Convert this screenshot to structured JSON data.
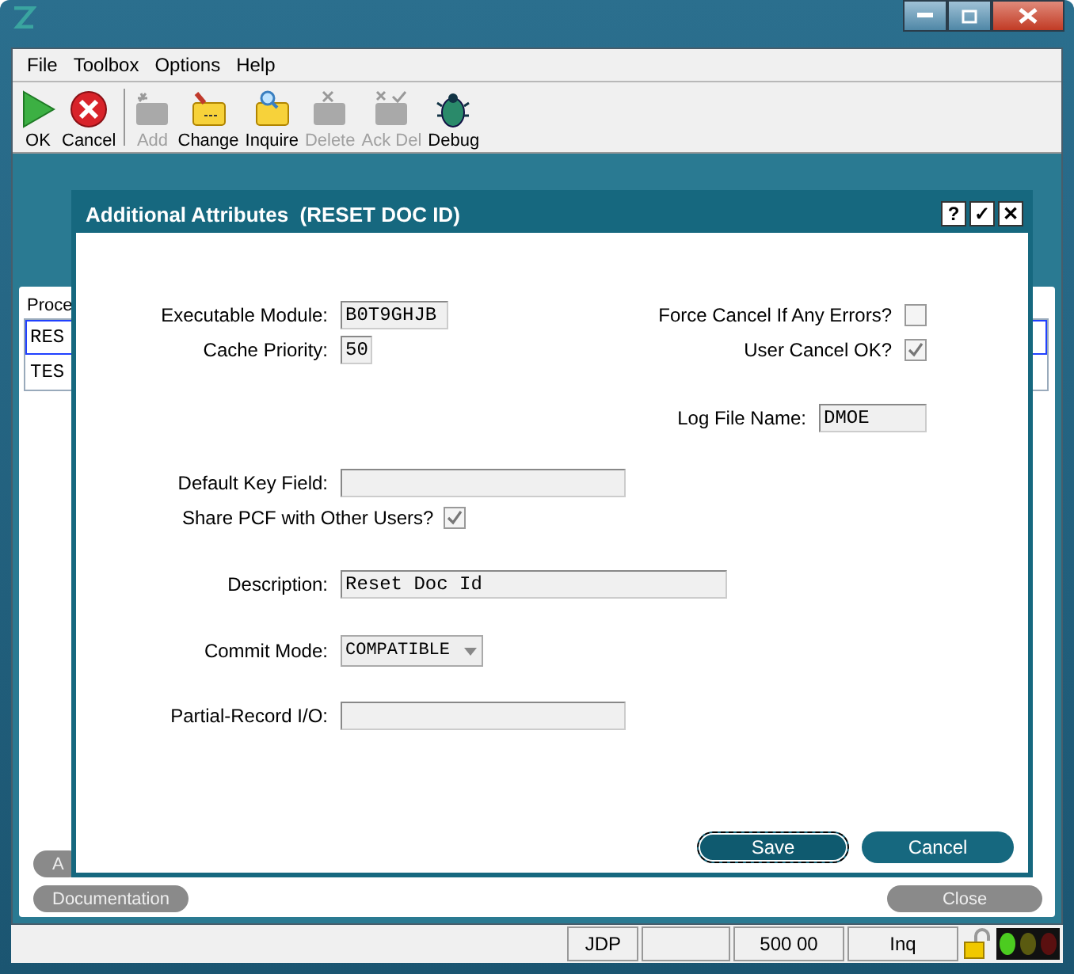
{
  "menu": [
    "File",
    "Toolbox",
    "Options",
    "Help"
  ],
  "toolbar": [
    {
      "kind": "ok",
      "label": "OK",
      "disabled": false
    },
    {
      "kind": "cancel",
      "label": "Cancel",
      "disabled": false
    },
    {
      "kind": "add",
      "label": "Add",
      "disabled": true
    },
    {
      "kind": "change",
      "label": "Change",
      "disabled": false
    },
    {
      "kind": "inquire",
      "label": "Inquire",
      "disabled": false
    },
    {
      "kind": "delete",
      "label": "Delete",
      "disabled": true
    },
    {
      "kind": "ackdel",
      "label": "Ack Del",
      "disabled": true
    },
    {
      "kind": "debug",
      "label": "Debug",
      "disabled": false
    }
  ],
  "background": {
    "list_header": "Proce",
    "rows": [
      {
        "text": "RES",
        "selected": true
      },
      {
        "text": "TES",
        "selected": false
      }
    ],
    "buttons": [
      "A",
      "Documentation",
      "Close"
    ]
  },
  "dialog": {
    "title": "Additional Attributes  (RESET DOC ID)",
    "title_buttons": [
      "?",
      "✓",
      "✕"
    ],
    "executable_module": {
      "label": "Executable Module:",
      "value": "B0T9GHJB"
    },
    "cache_priority": {
      "label": "Cache Priority:",
      "value": "50"
    },
    "force_cancel": {
      "label": "Force Cancel If Any Errors?",
      "checked": false
    },
    "user_cancel_ok": {
      "label": "User Cancel OK?",
      "checked": true
    },
    "log_file_name": {
      "label": "Log File Name:",
      "value": "DMOE"
    },
    "default_key_field": {
      "label": "Default Key Field:"
    },
    "share_pcf": {
      "label": "Share PCF with Other Users?",
      "checked": true
    },
    "description": {
      "label": "Description:",
      "value": "Reset Doc Id"
    },
    "commit_mode": {
      "label": "Commit Mode:",
      "value": "COMPATIBLE"
    },
    "partial_record_io": {
      "label": "Partial-Record I/O:"
    },
    "buttons": [
      {
        "label": "Save",
        "focused": true
      },
      {
        "label": "Cancel",
        "focused": false
      }
    ]
  },
  "status_bar": {
    "cells": [
      "JDP",
      "500 00",
      "Inq"
    ]
  }
}
